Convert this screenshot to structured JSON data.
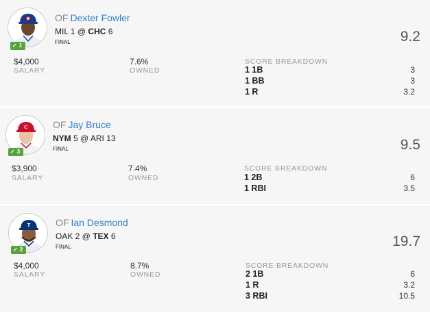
{
  "players": [
    {
      "position": "OF",
      "name": "Dexter Fowler",
      "game_part1": "MIL 1 @ ",
      "game_bold": "CHC",
      "game_part2": " 6",
      "status": "FINAL",
      "points": "9.2",
      "badge": "1",
      "salary": "$4,000",
      "salary_label": "SALARY",
      "owned": "7.6%",
      "owned_label": "OWNED",
      "breakdown_title": "SCORE BREAKDOWN",
      "breakdown": [
        {
          "stat": "1 1B",
          "pts": "3"
        },
        {
          "stat": "1 BB",
          "pts": "3"
        },
        {
          "stat": "1 R",
          "pts": "3.2"
        }
      ]
    },
    {
      "position": "OF",
      "name": "Jay Bruce",
      "game_bold": "NYM",
      "game_part1": " 5  @ ARI 13",
      "status": "FINAL",
      "points": "9.5",
      "badge": "3",
      "salary": "$3,900",
      "salary_label": "SALARY",
      "owned": "7.4%",
      "owned_label": "OWNED",
      "breakdown_title": "SCORE BREAKDOWN",
      "breakdown": [
        {
          "stat": "1 2B",
          "pts": "6"
        },
        {
          "stat": "1 RBI",
          "pts": "3.5"
        }
      ]
    },
    {
      "position": "OF",
      "name": "Ian Desmond",
      "game_part1": "OAK 2  @ ",
      "game_bold": "TEX",
      "game_part2": " 6",
      "status": "FINAL",
      "points": "19.7",
      "badge": "2",
      "salary": "$4,000",
      "salary_label": "SALARY",
      "owned": "8.7%",
      "owned_label": "OWNED",
      "breakdown_title": "SCORE BREAKDOWN",
      "breakdown": [
        {
          "stat": "2 1B",
          "pts": "6"
        },
        {
          "stat": "1 R",
          "pts": "3.2"
        },
        {
          "stat": "3 RBI",
          "pts": "10.5"
        }
      ]
    }
  ],
  "colors": {
    "link": "#2e7fd0",
    "badge": "#5aa23d",
    "card_bg": "#f6f6f6"
  },
  "icons": [
    "checkmark-icon",
    "player-headshot-cubs",
    "player-headshot-reds",
    "player-headshot-rangers"
  ]
}
